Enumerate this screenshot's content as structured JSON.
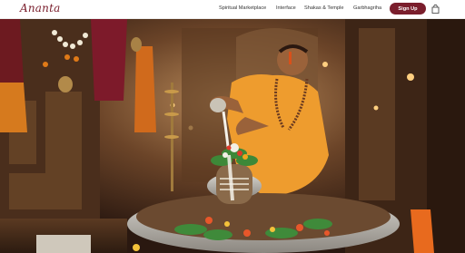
{
  "brand": {
    "logo_text": "Ananta",
    "accent": "#7a1e2c"
  },
  "nav": {
    "links": [
      {
        "label": "Spiritual Marketplace"
      },
      {
        "label": "Interface"
      },
      {
        "label": "Shakas & Temple"
      },
      {
        "label": "Garbhagriha"
      }
    ],
    "signup_label": "Sign Up",
    "cart_icon": "shopping-bag-icon"
  },
  "hero": {
    "image": "temple-priest-abhishek-photo"
  }
}
